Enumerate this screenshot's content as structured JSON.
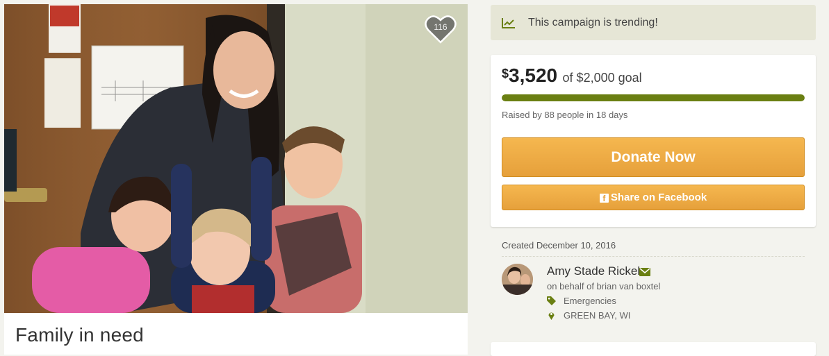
{
  "campaign": {
    "title": "Family in need",
    "hearts": "116"
  },
  "trending": {
    "label": "This campaign is trending!",
    "icon": "trending-chart-icon"
  },
  "goal": {
    "currency_symbol": "$",
    "raised": "3,520",
    "goal_text": "of $2,000 goal",
    "progress_fraction": 1.0,
    "raised_by": "Raised by 88 people in 18 days"
  },
  "actions": {
    "donate_label": "Donate Now",
    "share_label": "Share on Facebook"
  },
  "organizer": {
    "created": "Created December 10, 2016",
    "name": "Amy Stade Rickel",
    "on_behalf": "on behalf of brian van boxtel",
    "category": "Emergencies",
    "location": "GREEN BAY, WI"
  },
  "colors": {
    "accent_green": "#6a7f12",
    "donate_orange": "#eba742",
    "trending_bg": "#e6e6d6"
  }
}
